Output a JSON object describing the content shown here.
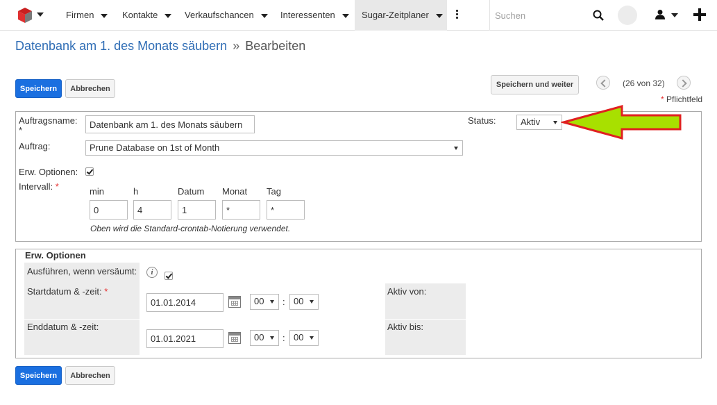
{
  "nav": {
    "tabs": [
      {
        "label": "Firmen"
      },
      {
        "label": "Kontakte"
      },
      {
        "label": "Verkaufschancen"
      },
      {
        "label": "Interessenten"
      },
      {
        "label": "Sugar-Zeitplaner"
      }
    ],
    "search_placeholder": "Suchen"
  },
  "title": {
    "record": "Datenbank am 1. des Monats säubern",
    "separator": "»",
    "mode": "Bearbeiten"
  },
  "buttons": {
    "save": "Speichern",
    "cancel": "Abbrechen",
    "save_continue": "Speichern und weiter"
  },
  "pager": {
    "text": "(26 von 32)"
  },
  "required_note": {
    "asterisk": "*",
    "text": "Pflichtfeld"
  },
  "main_panel": {
    "job_name_label": "Auftragsname:",
    "job_name_value": "Datenbank am 1. des Monats säubern",
    "status_label": "Status:",
    "status_value": "Aktiv",
    "job_label": "Auftrag:",
    "job_value": "Prune Database on 1st of Month",
    "adv_options_label": "Erw. Optionen:",
    "interval_label": "Intervall:",
    "interval_headers": [
      "min",
      "h",
      "Datum",
      "Monat",
      "Tag"
    ],
    "interval_values": [
      "0",
      "4",
      "1",
      "*",
      "*"
    ],
    "hint": "Oben wird die Standard-crontab-Notierung verwendet."
  },
  "adv_panel": {
    "title": "Erw. Optionen",
    "run_missed_label": "Ausführen, wenn versäumt:",
    "start_label": "Startdatum & -zeit:",
    "start_date": "01.01.2014",
    "start_hour": "00",
    "start_min": "00",
    "end_label": "Enddatum & -zeit:",
    "end_date": "01.01.2021",
    "end_hour": "00",
    "end_min": "00",
    "active_from_label": "Aktiv von:",
    "active_to_label": "Aktiv bis:",
    "time_sep": ":"
  },
  "colors": {
    "primary": "#1a6fe0",
    "link": "#2f6db5",
    "arrow_fill": "#a8e000",
    "arrow_stroke": "#e02020"
  }
}
